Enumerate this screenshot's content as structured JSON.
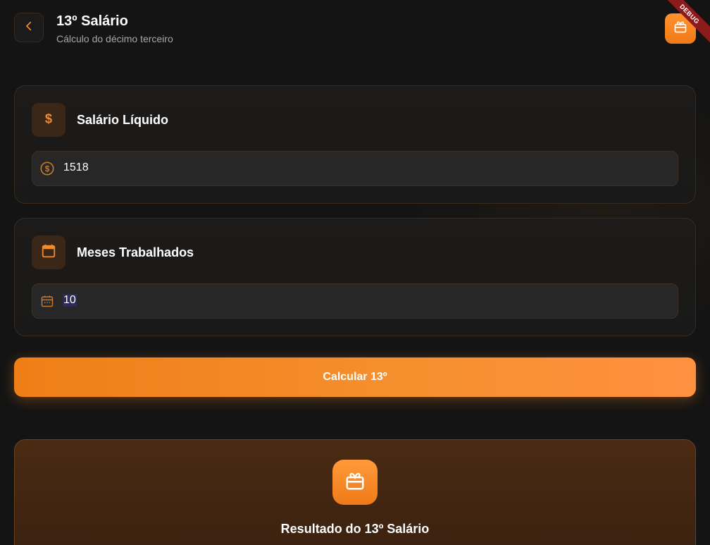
{
  "header": {
    "title": "13º Salário",
    "subtitle": "Cálculo do décimo terceiro",
    "back_icon": "chevron-left-icon",
    "action_icon": "gift-icon",
    "debug_banner": "DEBUG"
  },
  "salary_card": {
    "title": "Salário Líquido",
    "icon": "dollar-icon",
    "input": {
      "icon": "coin-icon",
      "value": "1518"
    }
  },
  "months_card": {
    "title": "Meses Trabalhados",
    "icon": "calendar-icon",
    "input": {
      "icon": "calendar-small-icon",
      "value": "10"
    }
  },
  "calculate_button": {
    "label": "Calcular 13º"
  },
  "result": {
    "title": "Resultado do 13º Salário",
    "icon": "gift-icon"
  },
  "colors": {
    "accent": "#F58A24",
    "background": "#141414",
    "card": "#1B1A19",
    "field": "#272727",
    "result_bg": "#3F2411",
    "debug": "#8E1B1B"
  }
}
